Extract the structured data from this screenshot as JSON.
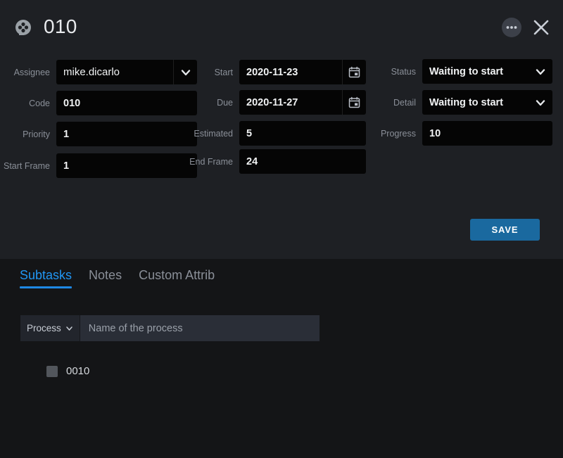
{
  "window": {
    "title": "010",
    "icon": "film-reel-icon",
    "more_icon": "more-options-icon",
    "close_icon": "close-icon",
    "accent_color": "#1e88e5",
    "save_button_color": "#1a699f",
    "panel_bg": "#1e2024",
    "lower_panel_bg": "#141517",
    "field_bg": "#050505"
  },
  "form": {
    "column_left": [
      {
        "label": "Assignee",
        "value": "mike.dicarlo",
        "type": "select",
        "icon": "chevron-down-icon"
      },
      {
        "label": "Code",
        "value": "010",
        "type": "text"
      },
      {
        "label": "Priority",
        "value": "1",
        "type": "text"
      },
      {
        "label": "Start Frame",
        "value": "1",
        "type": "text"
      }
    ],
    "column_middle": [
      {
        "label": "Start",
        "value": "2020-11-23",
        "type": "date",
        "icon": "calendar-icon"
      },
      {
        "label": "Due",
        "value": "2020-11-27",
        "type": "date",
        "icon": "calendar-icon"
      },
      {
        "label": "Estimated",
        "value": "5",
        "type": "text"
      },
      {
        "label": "End Frame",
        "value": "24",
        "type": "text"
      }
    ],
    "column_right": [
      {
        "label": "Status",
        "value": "Waiting to start",
        "type": "select",
        "icon": "chevron-down-icon"
      },
      {
        "label": "Detail",
        "value": "Waiting to start",
        "type": "select",
        "icon": "chevron-down-icon"
      },
      {
        "label": "Progress",
        "value": "10",
        "type": "text"
      }
    ],
    "save_label": "SAVE"
  },
  "tabs": [
    {
      "label": "Subtasks",
      "active": true
    },
    {
      "label": "Notes",
      "active": false
    },
    {
      "label": "Custom Attrib",
      "active": false
    }
  ],
  "subtasks": {
    "process_select_label": "Process",
    "process_input_placeholder": "Name of the process",
    "items": [
      {
        "label": "0010",
        "checked": false
      }
    ]
  }
}
